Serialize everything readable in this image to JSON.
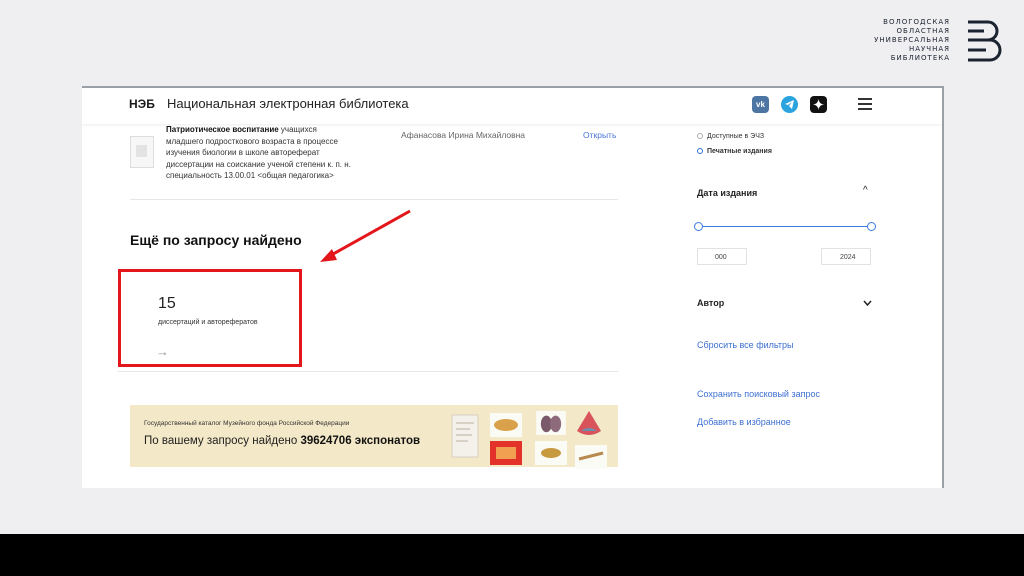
{
  "logo": {
    "lines": [
      "ВОЛОГОДСКАЯ",
      "ОБЛАСТНАЯ",
      "УНИВЕРСАЛЬНАЯ",
      "НАУЧНАЯ",
      "БИБЛИОТЕКА"
    ]
  },
  "header": {
    "brand": "НЭБ",
    "name": "Национальная электронная библиотека",
    "social": [
      "vk-icon",
      "telegram-icon",
      "dzen-icon"
    ],
    "menu_icon": "burger-menu-icon"
  },
  "result": {
    "title_bold": "Патриотическое воспитание",
    "title_rest_1": " учащихся",
    "line2": "младшего подросткового возраста в процессе",
    "line3": "изучения биологии в школе автореферат",
    "line4": "диссертации на соискание ученой степени к. п. н.",
    "line5": "специальность 13.00.01 <общая педагогика>",
    "author": "Афанасова Ирина Михайловна",
    "open": "Открыть"
  },
  "more": {
    "title": "Ещё по запросу найдено",
    "count": "15",
    "label": "диссертаций и авторефератов",
    "arrow": "→"
  },
  "museum": {
    "caption": "Государственный каталог Музейного фонда Российской Федерации",
    "text_prefix": "По вашему запросу найдено ",
    "count": "39624706",
    "text_suffix": " экспонатов"
  },
  "sidebar": {
    "opt_available": "Доступные в ЭЧЗ",
    "opt_printed": "Печатные издания",
    "date_heading": "Дата издания",
    "year_from": "000",
    "year_to": "2024",
    "author_heading": "Автор",
    "reset": "Сбросить все фильтры",
    "save_query": "Сохранить поисковый запрос",
    "add_fav": "Добавить в избранное"
  },
  "colors": {
    "highlight": "#e3171b",
    "link": "#3d6fd0",
    "museum_bg": "#f3e8c7"
  }
}
